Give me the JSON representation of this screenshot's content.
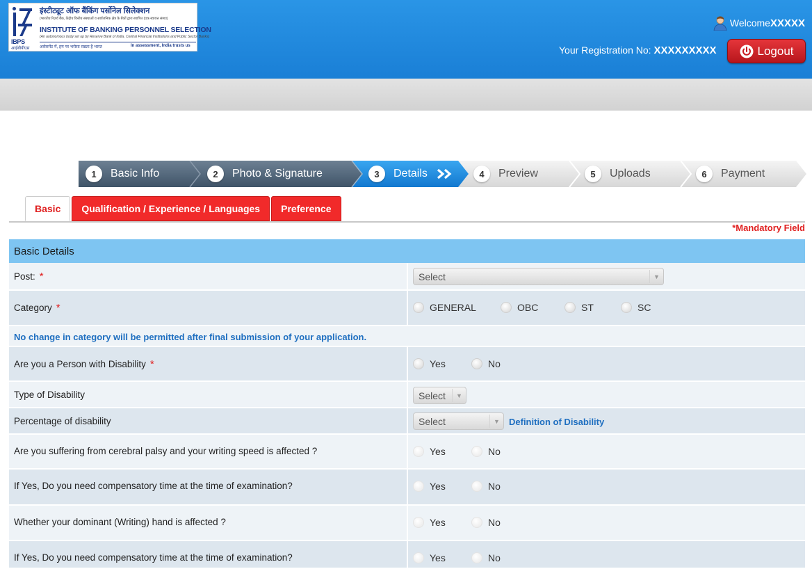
{
  "header": {
    "logo": {
      "hindi_title": "इंस्टीट्यूट ऑफ बैंकिंग पर्सोनेल सिलेक्शन",
      "hindi_sub": "(भारतीय रिज़र्व बैंक, केंद्रीय वित्तीय संस्थाओं व सार्वजनिक क्षेत्र के बैंकों द्वारा स्थापित (एक स्वायत्त संस्था)",
      "english_title": "INSTITUTE OF BANKING PERSONNEL SELECTION",
      "english_sub": "(An autonomous body set up by Reserve Bank of India, Central Financial Institutions and Public Sector Banks)",
      "tagline_hindi": "असेसमेंट में, हम पर भरोसा रखता है भारत",
      "tagline_english": "In assessment, India trusts us",
      "mark_text": "IBPS",
      "mark_hindi": "आईबीपीएस"
    },
    "welcome_label": "Welcome",
    "welcome_name": "XXXXX",
    "registration_label": "Your Registration No: ",
    "registration_no": "XXXXXXXXX",
    "logout_label": "Logout"
  },
  "steps": [
    {
      "num": "1",
      "label": "Basic Info",
      "state": "done"
    },
    {
      "num": "2",
      "label": "Photo & Signature",
      "state": "done"
    },
    {
      "num": "3",
      "label": "Details",
      "state": "active"
    },
    {
      "num": "4",
      "label": "Preview",
      "state": "todo"
    },
    {
      "num": "5",
      "label": "Uploads",
      "state": "todo"
    },
    {
      "num": "6",
      "label": "Payment",
      "state": "todo"
    }
  ],
  "tabs": [
    {
      "label": "Basic",
      "active": true
    },
    {
      "label": "Qualification / Experience / Languages",
      "active": false
    },
    {
      "label": "Preference",
      "active": false
    }
  ],
  "mandatory_label": "*Mandatory Field",
  "section_title": "Basic Details",
  "form": {
    "post": {
      "label": "Post:",
      "required": "*",
      "placeholder": "Select"
    },
    "category": {
      "label": "Category",
      "required": "*",
      "options": [
        "GENERAL",
        "OBC",
        "ST",
        "SC"
      ]
    },
    "category_note": "No change in category will be permitted after final submission of your application.",
    "pwd": {
      "label": "Are you a Person with Disability",
      "required": "*",
      "options": [
        "Yes",
        "No"
      ]
    },
    "disability_type": {
      "label": "Type of Disability",
      "placeholder": "Select"
    },
    "disability_pct": {
      "label": "Percentage of disability",
      "placeholder": "Select",
      "link": "Definition of Disability"
    },
    "cerebral_palsy": {
      "label": "Are you suffering from cerebral palsy and your writing speed is affected ?",
      "options": [
        "Yes",
        "No"
      ]
    },
    "compensatory": {
      "label": "If Yes, Do you need compensatory time at the time of examination?",
      "options": [
        "Yes",
        "No"
      ]
    },
    "dominant_hand": {
      "label": "Whether your dominant (Writing) hand is affected ?",
      "options": [
        "Yes",
        "No"
      ]
    },
    "next_row": {
      "label": "If Yes, Do you need compensatory time at the time of examination?",
      "options": [
        "Yes",
        "No"
      ]
    }
  },
  "colors": {
    "header_blue": "#1a7fd6",
    "step_done": "#4f6478",
    "step_active": "#1e8ee0",
    "tab_red": "#f12a2a",
    "section_head": "#7ec5f2",
    "row_shade": "#dde6ee",
    "mandatory_red": "#e02020",
    "note_blue": "#1f6fc0"
  }
}
